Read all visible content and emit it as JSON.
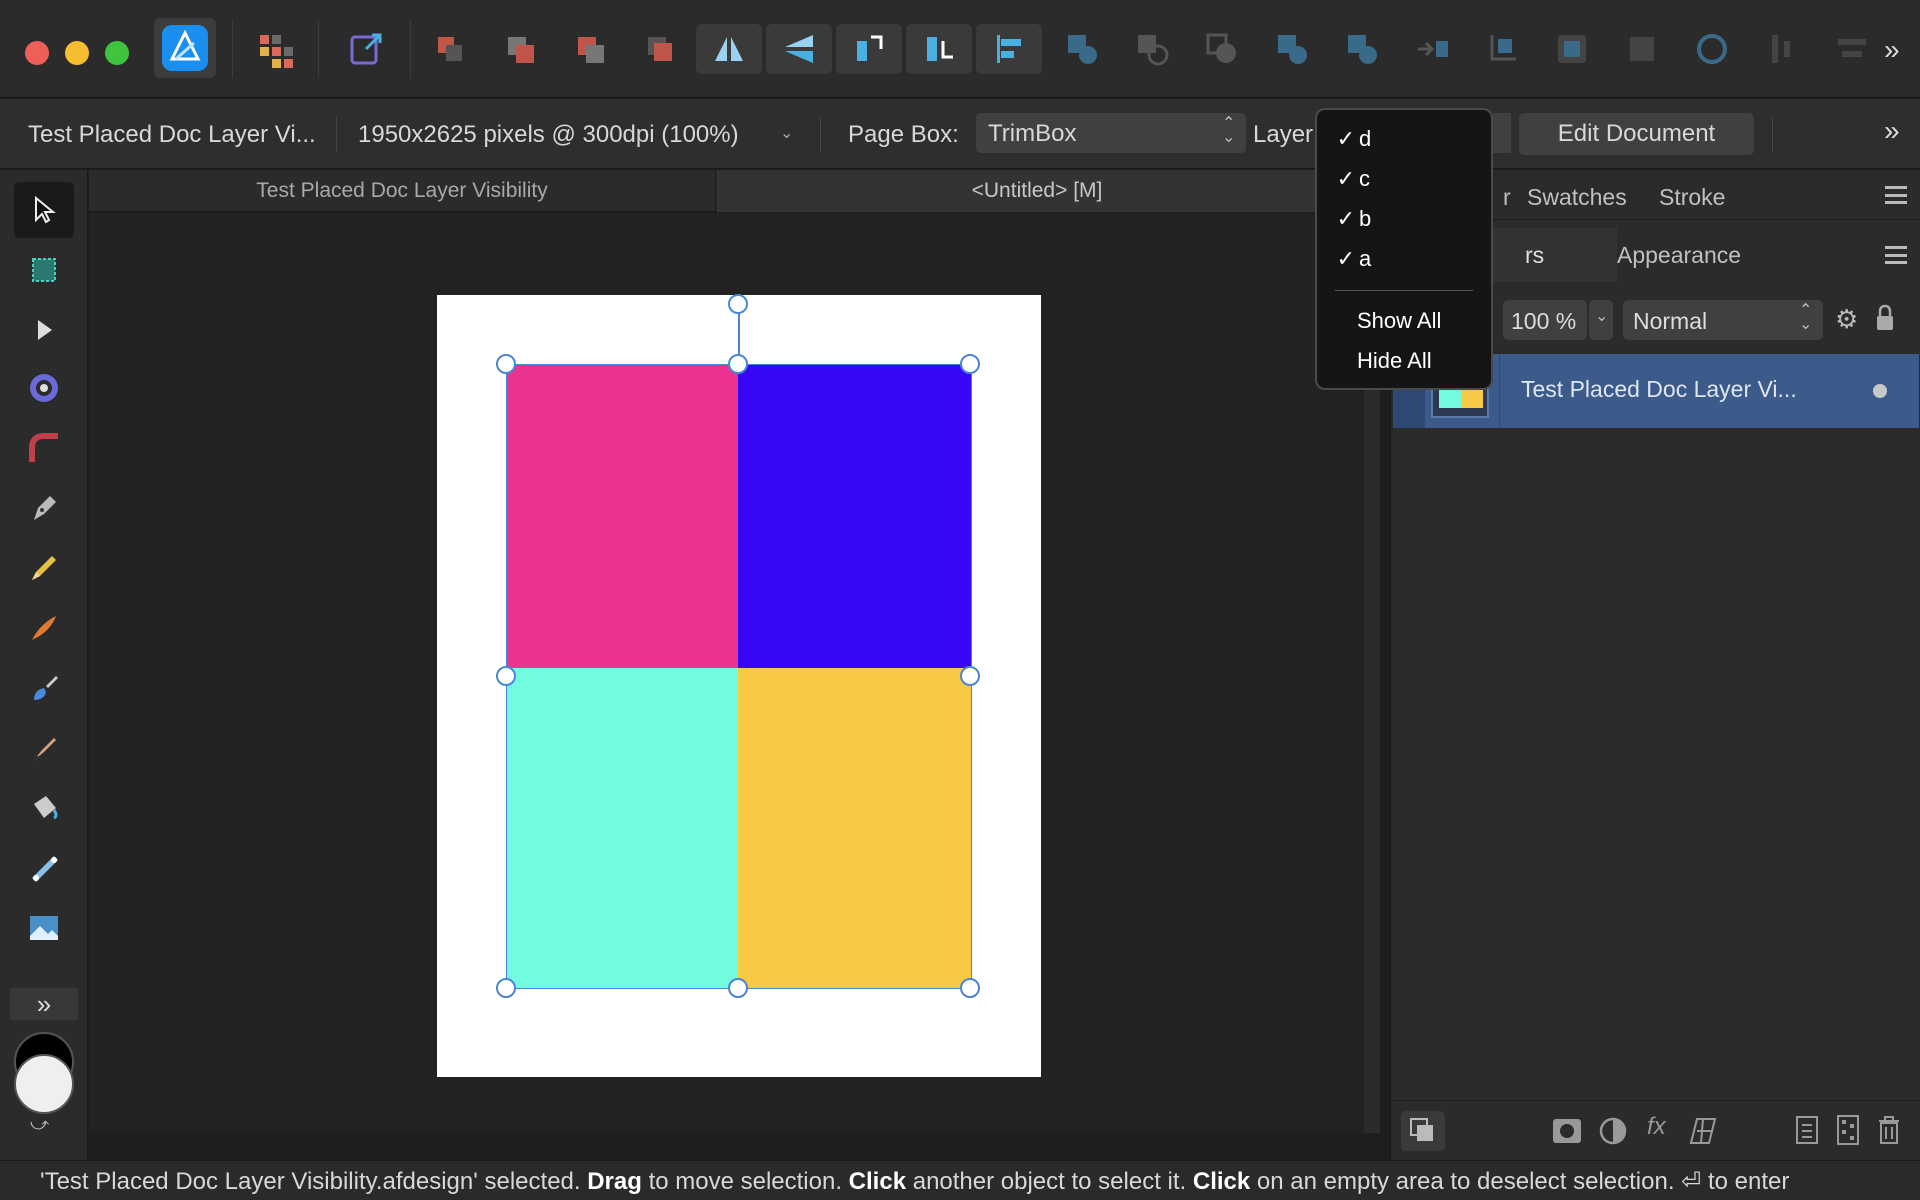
{
  "toolbar": {
    "overflow_label": "»"
  },
  "context_bar": {
    "doc_name": "Test Placed Doc Layer Vi...",
    "doc_info": "1950x2625 pixels @ 300dpi (100%)",
    "page_box_label": "Page Box:",
    "page_box_value": "TrimBox",
    "layers_label": "Layer",
    "edit_document_label": "Edit Document",
    "overflow_label": "»"
  },
  "doc_tabs": [
    {
      "label": "Test Placed Doc Layer Visibility"
    },
    {
      "label": "<Untitled> [M]"
    }
  ],
  "canvas": {
    "quadrant_colors": {
      "top_left": "#e9338e",
      "top_right": "#3706f5",
      "bottom_left": "#73fbdf",
      "bottom_right": "#f6ca45"
    }
  },
  "layer_menu": {
    "items": [
      {
        "label": "d",
        "checked": "✓"
      },
      {
        "label": "c",
        "checked": "✓"
      },
      {
        "label": "b",
        "checked": "✓"
      },
      {
        "label": "a",
        "checked": "✓"
      }
    ],
    "show_all": "Show All",
    "hide_all": "Hide All"
  },
  "right_panel": {
    "top_tabs": {
      "partial": "r",
      "swatches": "Swatches",
      "stroke": "Stroke"
    },
    "second_tabs": {
      "layers_partial": "rs",
      "appearance": "Appearance"
    },
    "opacity": "100 %",
    "blend_mode": "Normal",
    "layer_row": {
      "name": "Test Placed Doc Layer Vi..."
    }
  },
  "tools": {
    "expand_label": "»"
  },
  "status": {
    "p1": "'Test Placed Doc Layer Visibility.afdesign' selected. ",
    "b1": "Drag",
    "p2": " to move selection. ",
    "b2": "Click",
    "p3": " another object to select it. ",
    "b3": "Click",
    "p4": " on an empty area to deselect selection. ",
    "p5": "⏎ to enter"
  }
}
